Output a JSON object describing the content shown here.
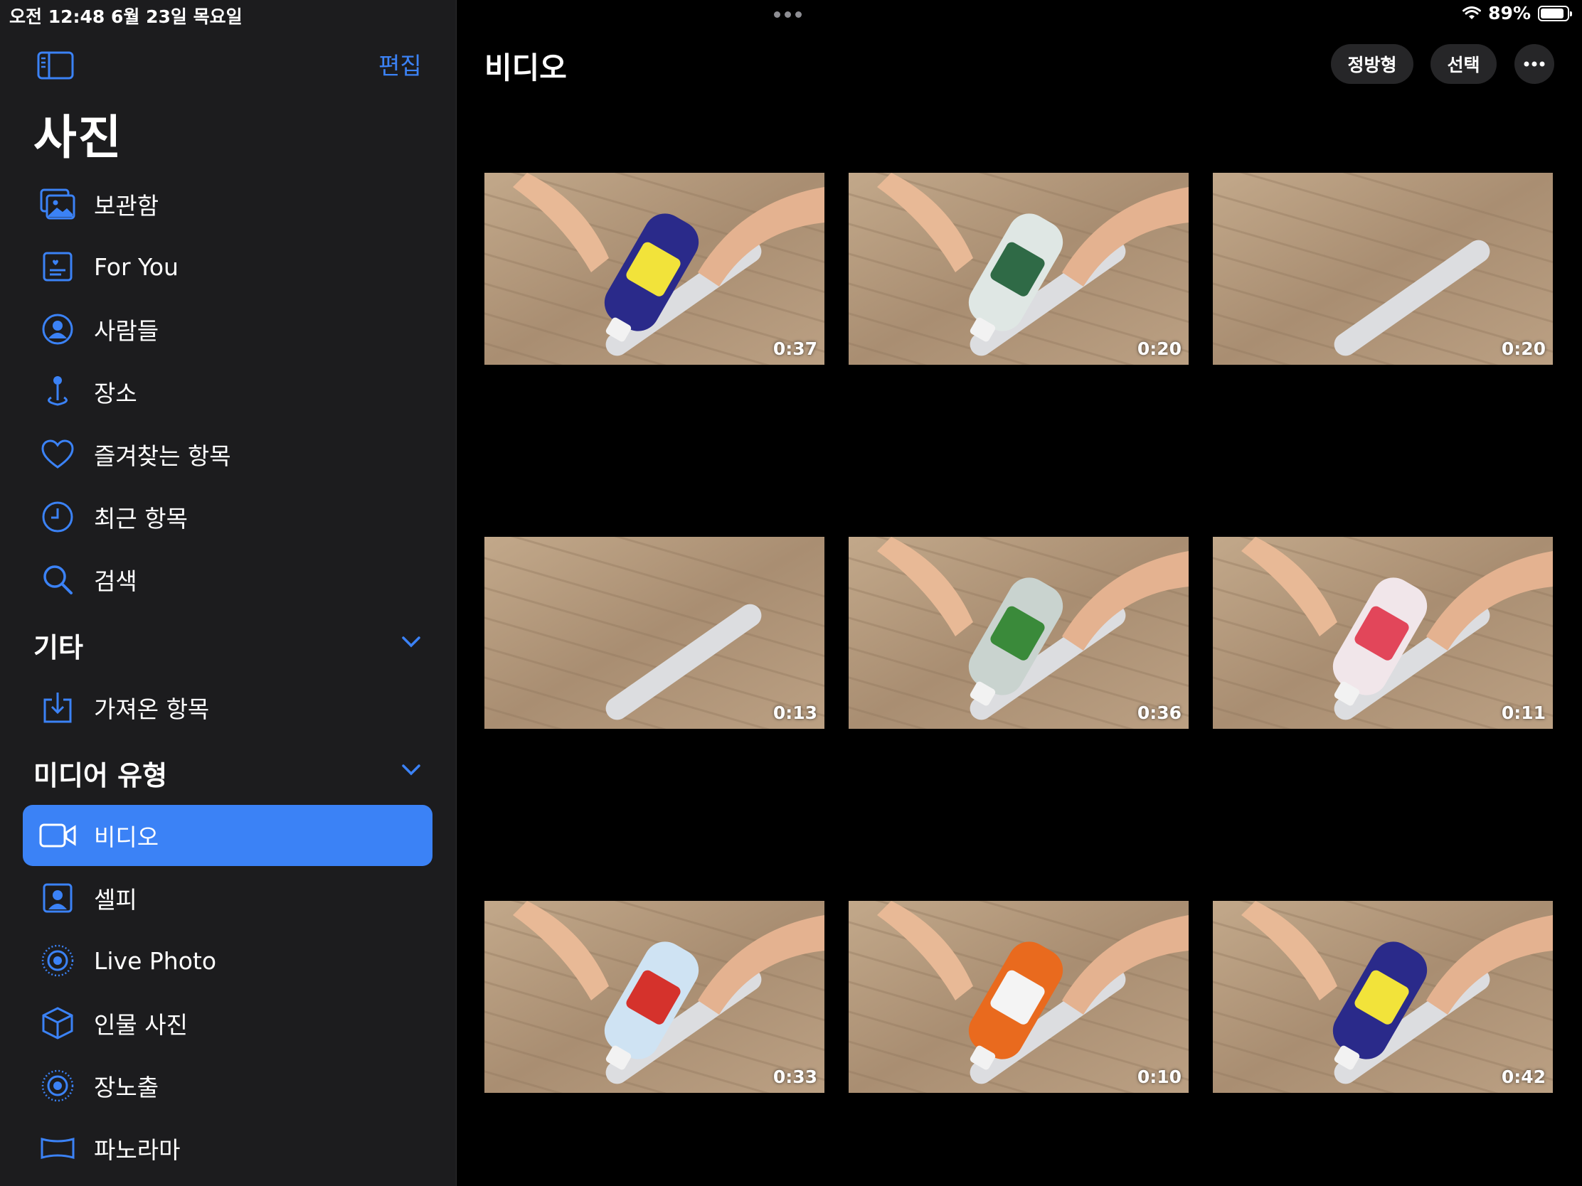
{
  "status_bar": {
    "time": "오전 12:48   6월 23일 목요일",
    "battery": "89%"
  },
  "sidebar": {
    "edit_label": "편집",
    "title": "사진",
    "items": [
      {
        "label": "보관함",
        "icon": "library-icon"
      },
      {
        "label": "For You",
        "icon": "for-you-icon"
      },
      {
        "label": "사람들",
        "icon": "people-icon"
      },
      {
        "label": "장소",
        "icon": "places-icon"
      },
      {
        "label": "즐겨찾는 항목",
        "icon": "heart-icon"
      },
      {
        "label": "최근 항목",
        "icon": "clock-icon"
      },
      {
        "label": "검색",
        "icon": "search-icon"
      }
    ],
    "other_section": {
      "title": "기타",
      "items": [
        {
          "label": "가져온 항목",
          "icon": "import-icon"
        }
      ]
    },
    "media_section": {
      "title": "미디어 유형",
      "items": [
        {
          "label": "비디오",
          "icon": "video-icon",
          "selected": true
        },
        {
          "label": "셀피",
          "icon": "selfie-icon"
        },
        {
          "label": "Live Photo",
          "icon": "live-photo-icon"
        },
        {
          "label": "인물 사진",
          "icon": "portrait-cube-icon"
        },
        {
          "label": "장노출",
          "icon": "long-exposure-icon"
        },
        {
          "label": "파노라마",
          "icon": "panorama-icon"
        }
      ]
    }
  },
  "main": {
    "title": "비디오",
    "buttons": {
      "aspect": "정방형",
      "select": "선택",
      "more_icon": "ellipsis-icon"
    },
    "videos": [
      {
        "duration": "0:37",
        "bottle": "#2a2a8a",
        "bottle_accent": "#f2e33a"
      },
      {
        "duration": "0:20",
        "bottle": "#dfe7e4",
        "bottle_accent": "#2f6a46"
      },
      {
        "duration": "0:20",
        "bottle": "",
        "bottle_accent": ""
      },
      {
        "duration": "0:13",
        "bottle": "",
        "bottle_accent": ""
      },
      {
        "duration": "0:36",
        "bottle": "#c9d3cf",
        "bottle_accent": "#3a8a3a"
      },
      {
        "duration": "0:11",
        "bottle": "#f1e6ea",
        "bottle_accent": "#e2465a"
      },
      {
        "duration": "0:33",
        "bottle": "#cfe3f3",
        "bottle_accent": "#d5322c"
      },
      {
        "duration": "0:10",
        "bottle": "#e96a1e",
        "bottle_accent": "#f4f4f4"
      },
      {
        "duration": "0:42",
        "bottle": "#2a2a8a",
        "bottle_accent": "#f2e33a"
      }
    ]
  },
  "colors": {
    "accent": "#3b82f6",
    "sidebar_bg": "#1c1c1e",
    "main_bg": "#000000",
    "wood": "#b59a7c"
  }
}
